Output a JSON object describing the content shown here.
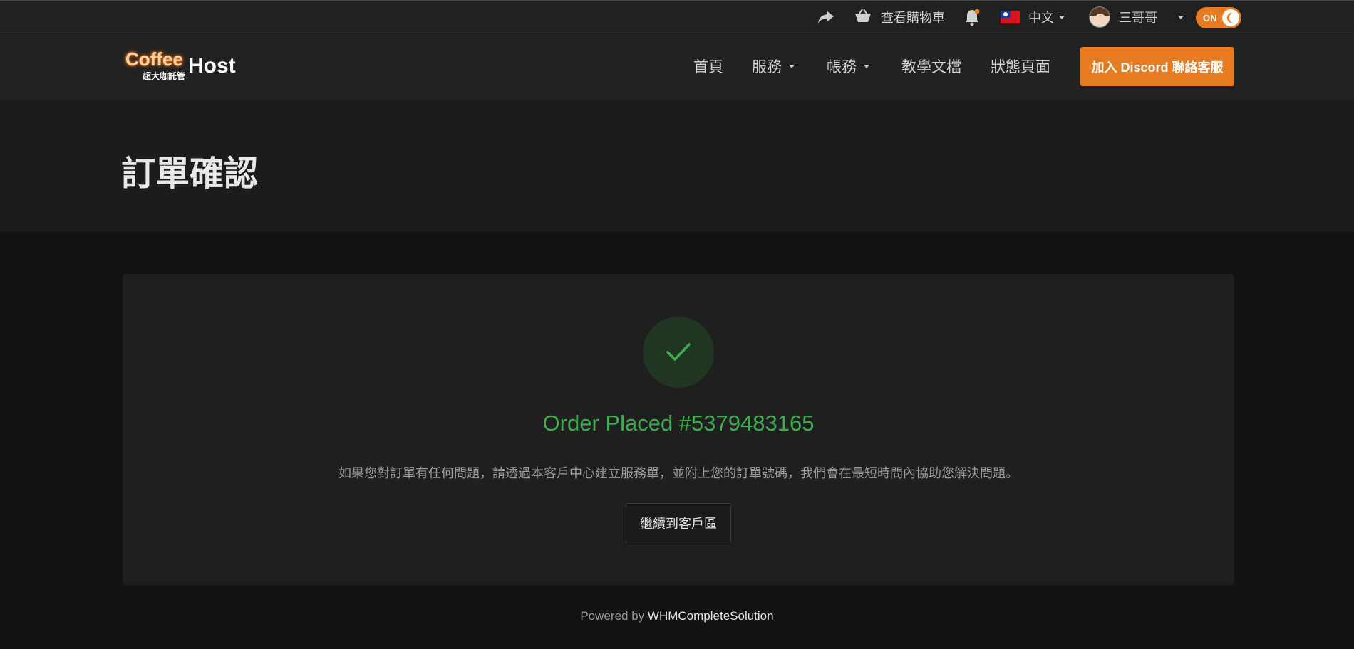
{
  "topbar": {
    "cart_label": "查看購物車",
    "language_label": "中文",
    "user_name": "三哥哥",
    "theme_toggle_label": "ON"
  },
  "navbar": {
    "logo_primary": "Coffee",
    "logo_secondary": "Host",
    "logo_subtitle": "超大咖託管",
    "home": "首頁",
    "services": "服務",
    "account": "帳務",
    "docs": "教學文檔",
    "status": "狀態頁面",
    "discord_button": "加入 Discord 聯絡客服"
  },
  "page": {
    "title": "訂單確認"
  },
  "order": {
    "title": "Order Placed #5379483165",
    "message": "如果您對訂單有任何問題，請透過本客戶中心建立服務單，並附上您的訂單號碼，我們會在最短時間內協助您解決問題。",
    "continue_button": "繼續到客戶區"
  },
  "footer": {
    "powered_prefix": "Powered by",
    "powered_brand": "WHMCompleteSolution"
  },
  "colors": {
    "accent": "#e77b22",
    "success": "#3cae4d"
  }
}
